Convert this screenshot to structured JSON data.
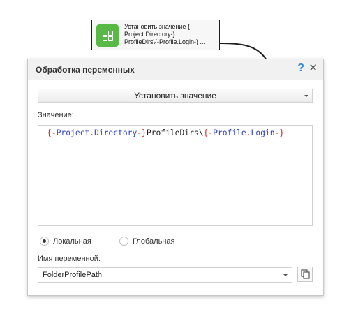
{
  "node": {
    "icon": "grid-icon",
    "lines": [
      "Установить значение {-",
      "Project.Directory-}",
      "ProfileDirs\\{-Profile.Login-} ..."
    ],
    "accent": "#58b947"
  },
  "dialog": {
    "title": "Обработка переменных",
    "help_label": "?",
    "close_label": "✕",
    "action_select": "Установить значение",
    "value_label": "Значение:",
    "value_text": "{-Project.Directory-}ProfileDirs\\{-Profile.Login-}",
    "scope_options": [
      {
        "label": "Локальная",
        "checked": true
      },
      {
        "label": "Глобальная",
        "checked": false
      }
    ],
    "varname_label": "Имя переменной:",
    "varname_value": "FolderProfilePath",
    "copy_icon": "copy-icon"
  },
  "colors": {
    "brace": "#d62020",
    "keyword": "#2b3fc6",
    "help": "#2c87d8"
  }
}
